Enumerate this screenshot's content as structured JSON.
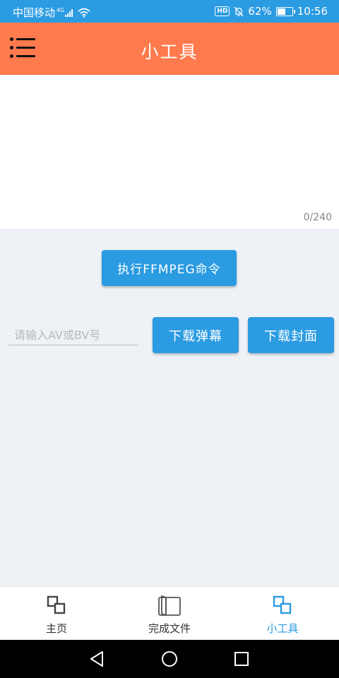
{
  "status_bar": {
    "carrier": "中国移动",
    "network": "4G",
    "battery": "62%",
    "battery_level": 0.62,
    "time": "10:56",
    "hd_label": "HD"
  },
  "app_bar": {
    "title": "小工具"
  },
  "command_box": {
    "value": "",
    "counter": "0/240"
  },
  "ffmpeg_button": {
    "label": "执行FFMPEG命令"
  },
  "av_input": {
    "value": "",
    "placeholder": "请输入AV或BV号"
  },
  "download_danmu_button": {
    "label": "下载弹幕"
  },
  "download_cover_button": {
    "label": "下载封面"
  },
  "bottom_nav": {
    "items": [
      {
        "label": "主页",
        "icon": "squares-icon",
        "active": false
      },
      {
        "label": "完成文件",
        "icon": "book-icon",
        "active": false
      },
      {
        "label": "小工具",
        "icon": "squares-icon",
        "active": true
      }
    ]
  },
  "colors": {
    "status_bar": "#2b9be2",
    "app_bar": "#ff7a4d",
    "accent": "#2b9be2",
    "background": "#eef2f6"
  }
}
